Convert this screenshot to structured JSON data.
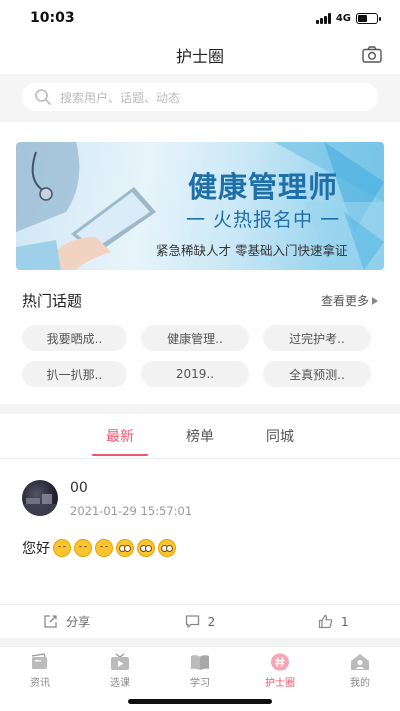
{
  "status": {
    "time": "10:03",
    "network": "4G",
    "battery_level": 0.55
  },
  "nav": {
    "title": "护士圈",
    "camera_icon": "camera-icon"
  },
  "search": {
    "placeholder": "搜索用户、话题、动态"
  },
  "banner": {
    "headline": "健康管理师",
    "subheadline": "一 火热报名中 一",
    "tagline": "紧急稀缺人才  零基础入门快速拿证"
  },
  "hot_topics": {
    "title": "热门话题",
    "more_label": "查看更多",
    "tags": [
      "我要晒成..",
      "健康管理..",
      "过完护考..",
      "扒一扒那..",
      "2019..",
      "全真预测.."
    ]
  },
  "feed_tabs": [
    {
      "label": "最新",
      "active": true
    },
    {
      "label": "榜单",
      "active": false
    },
    {
      "label": "同城",
      "active": false
    }
  ],
  "post": {
    "username": "00",
    "timestamp": "2021-01-29 15:57:01",
    "text": "您好",
    "emojis": [
      "smile",
      "smile",
      "smile",
      "rolling-eyes",
      "rolling-eyes",
      "rolling-eyes"
    ],
    "share_label": "分享",
    "comment_count": "2",
    "like_count": "1"
  },
  "tabbar": [
    {
      "label": "资讯",
      "icon": "news-icon",
      "active": false
    },
    {
      "label": "选课",
      "icon": "video-icon",
      "active": false
    },
    {
      "label": "学习",
      "icon": "book-icon",
      "active": false
    },
    {
      "label": "护士圈",
      "icon": "hashtag-icon",
      "active": true
    },
    {
      "label": "我的",
      "icon": "profile-icon",
      "active": false
    }
  ],
  "colors": {
    "accent": "#f0556e",
    "banner_blue": "#1f6fa8"
  }
}
